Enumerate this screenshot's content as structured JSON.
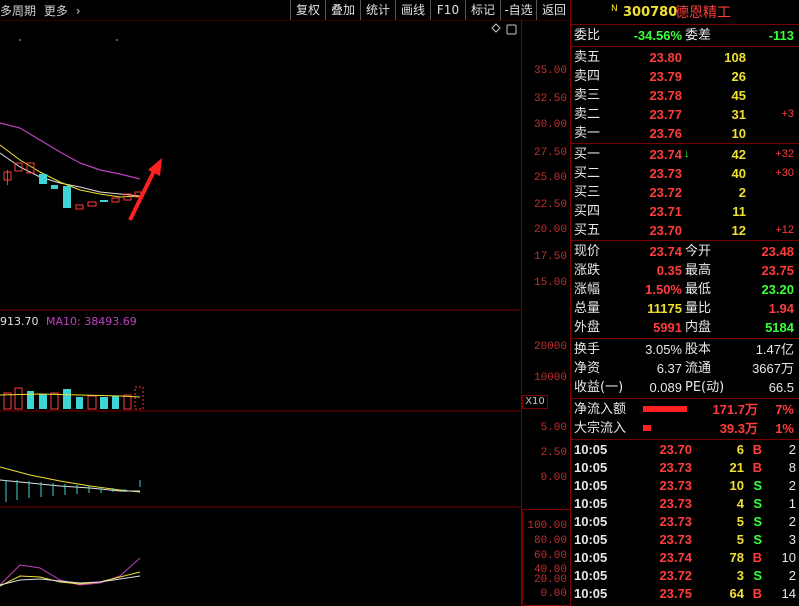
{
  "toolbar": {
    "period": "多周期",
    "more": "更多",
    "more_arrow": "›",
    "buttons": [
      "复权",
      "叠加",
      "统计",
      "画线",
      "F10",
      "标记",
      "-自选",
      "返回"
    ]
  },
  "chart": {
    "price_ticks": [
      "35.00",
      "32.50",
      "30.00",
      "27.50",
      "25.00",
      "22.50",
      "20.00",
      "17.50",
      "15.00"
    ],
    "ma_label_a": "913.70",
    "ma_label_b": "MA10: 38493.69",
    "volume_ticks": [
      "20000",
      "10000"
    ],
    "volume_multiplier": "X10",
    "macd_ticks": [
      "5.00",
      "2.50",
      "0.00"
    ],
    "kdj_ticks": [
      "100.00",
      "80.00",
      "60.00",
      "40.00",
      "20.00",
      "0.00"
    ]
  },
  "stock": {
    "badge": "N",
    "code": "300780",
    "name": "德恩精工"
  },
  "order_book": {
    "weibi_label": "委比",
    "weibi_value": "-34.56%",
    "weicha_label": "委差",
    "weicha_value": "-113",
    "asks": [
      {
        "label": "卖五",
        "price": "23.80",
        "vol": "108",
        "chg": ""
      },
      {
        "label": "卖四",
        "price": "23.79",
        "vol": "26",
        "chg": ""
      },
      {
        "label": "卖三",
        "price": "23.78",
        "vol": "45",
        "chg": ""
      },
      {
        "label": "卖二",
        "price": "23.77",
        "vol": "31",
        "chg": "+3"
      },
      {
        "label": "卖一",
        "price": "23.76",
        "vol": "10",
        "chg": ""
      }
    ],
    "bids": [
      {
        "label": "买一",
        "price": "23.74",
        "vol": "42",
        "chg": "+32",
        "arrow": "↓"
      },
      {
        "label": "买二",
        "price": "23.73",
        "vol": "40",
        "chg": "+30",
        "arrow": ""
      },
      {
        "label": "买三",
        "price": "23.72",
        "vol": "2",
        "chg": "",
        "arrow": ""
      },
      {
        "label": "买四",
        "price": "23.71",
        "vol": "11",
        "chg": "",
        "arrow": ""
      },
      {
        "label": "买五",
        "price": "23.70",
        "vol": "12",
        "chg": "+12",
        "arrow": ""
      }
    ]
  },
  "quote": [
    {
      "l1": "现价",
      "v1": "23.74",
      "c1": "red",
      "l2": "今开",
      "v2": "23.48",
      "c2": "red"
    },
    {
      "l1": "涨跌",
      "v1": "0.35",
      "c1": "red",
      "l2": "最高",
      "v2": "23.75",
      "c2": "red"
    },
    {
      "l1": "涨幅",
      "v1": "1.50%",
      "c1": "red",
      "l2": "最低",
      "v2": "23.20",
      "c2": "green"
    },
    {
      "l1": "总量",
      "v1": "11175",
      "c1": "yellow",
      "l2": "量比",
      "v2": "1.94",
      "c2": "red"
    },
    {
      "l1": "外盘",
      "v1": "5991",
      "c1": "red",
      "l2": "内盘",
      "v2": "5184",
      "c2": "green"
    }
  ],
  "fundamentals": [
    {
      "l1": "换手",
      "v1": "3.05%",
      "l2": "股本",
      "v2": "1.47亿"
    },
    {
      "l1": "净资",
      "v1": "6.37",
      "l2": "流通",
      "v2": "3667万"
    },
    {
      "l1": "收益(一)",
      "v1": "0.089",
      "l2": "PE(动)",
      "v2": "66.5"
    }
  ],
  "flows": [
    {
      "label": "净流入额",
      "value": "171.7万",
      "pct": "7%"
    },
    {
      "label": "大宗流入",
      "value": "39.3万",
      "pct": "1%"
    }
  ],
  "ticks": [
    {
      "time": "10:05",
      "price": "23.70",
      "pc": "red",
      "vol": "6",
      "side": "B",
      "n": "2"
    },
    {
      "time": "10:05",
      "price": "23.73",
      "pc": "red",
      "vol": "21",
      "side": "B",
      "n": "8"
    },
    {
      "time": "10:05",
      "price": "23.73",
      "pc": "red",
      "vol": "10",
      "side": "S",
      "n": "2"
    },
    {
      "time": "10:05",
      "price": "23.73",
      "pc": "red",
      "vol": "4",
      "side": "S",
      "n": "1"
    },
    {
      "time": "10:05",
      "price": "23.73",
      "pc": "red",
      "vol": "5",
      "side": "S",
      "n": "2"
    },
    {
      "time": "10:05",
      "price": "23.73",
      "pc": "red",
      "vol": "5",
      "side": "S",
      "n": "3"
    },
    {
      "time": "10:05",
      "price": "23.74",
      "pc": "red",
      "vol": "78",
      "side": "B",
      "n": "10"
    },
    {
      "time": "10:05",
      "price": "23.72",
      "pc": "red",
      "vol": "3",
      "side": "S",
      "n": "2"
    },
    {
      "time": "10:05",
      "price": "23.75",
      "pc": "red",
      "vol": "64",
      "side": "B",
      "n": "14"
    }
  ],
  "colors": {
    "up": "#ff3c3c",
    "down": "#3cff3c",
    "accent": "#f0e030",
    "border": "#7a0000"
  }
}
